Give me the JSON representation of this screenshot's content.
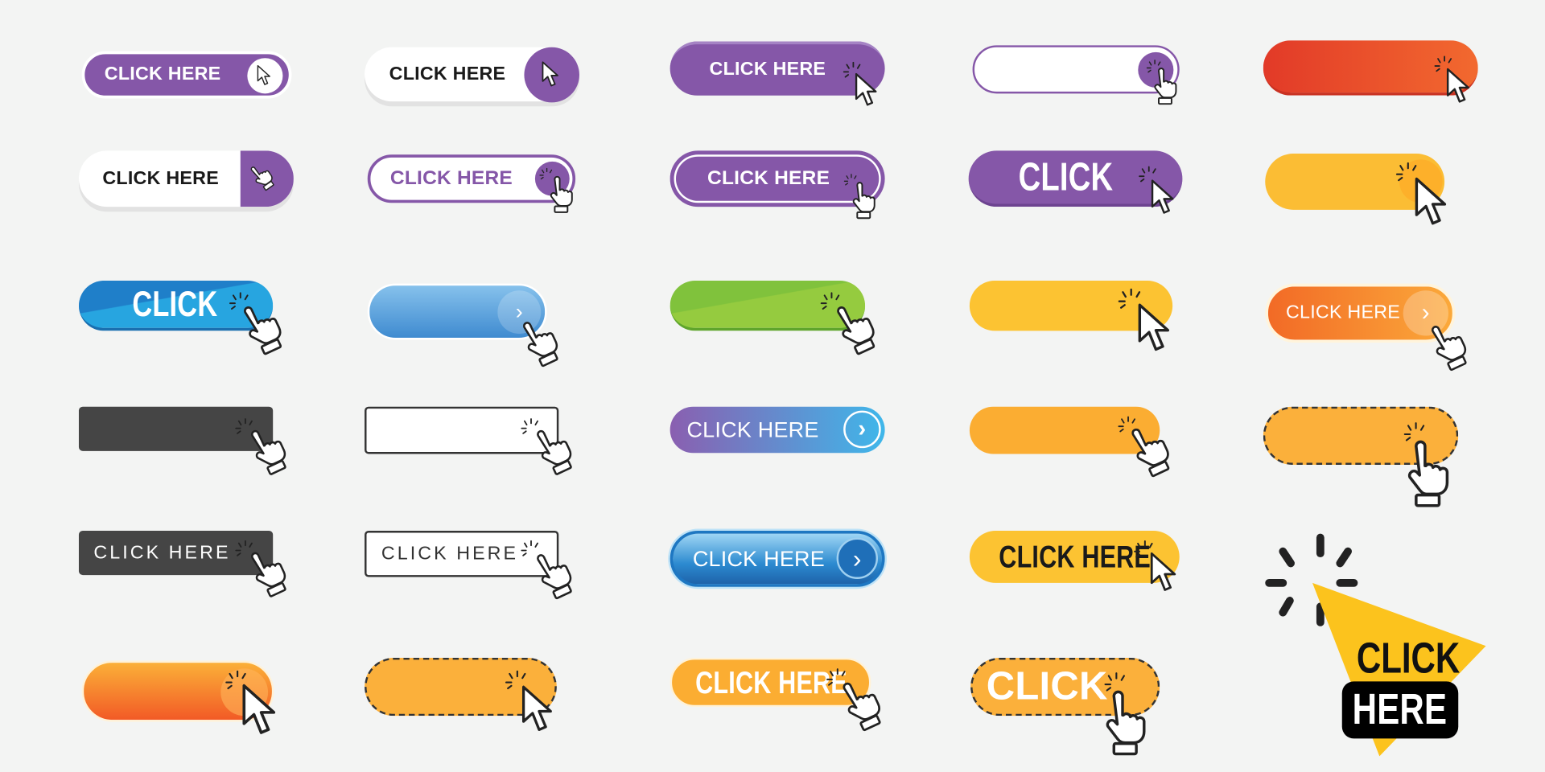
{
  "buttons": [
    {
      "label": "CLICK HERE",
      "color": "#8557a8",
      "icon": "arrow-cursor-icon"
    },
    {
      "label": "CLICK HERE",
      "color": "#ffffff",
      "accent": "#8557a8",
      "icon": "arrow-cursor-icon"
    },
    {
      "label": "CLICK HERE",
      "color": "#8557a8",
      "icon": "arrow-cursor-icon"
    },
    {
      "label": "",
      "color": "#ffffff",
      "accent": "#8557a8",
      "icon": "hand-pointer-icon"
    },
    {
      "label": "",
      "color": "#e8452c",
      "icon": "arrow-cursor-icon"
    },
    {
      "label": "CLICK HERE",
      "color": "#ffffff",
      "accent": "#8557a8",
      "icon": "hand-pointer-icon"
    },
    {
      "label": "CLICK HERE",
      "color": "#ffffff",
      "accent": "#8557a8",
      "icon": "hand-pointer-icon"
    },
    {
      "label": "CLICK HERE",
      "color": "#8557a8",
      "icon": "hand-pointer-icon"
    },
    {
      "label": "CLICK",
      "color": "#8557a8",
      "icon": "arrow-cursor-icon"
    },
    {
      "label": "",
      "color": "#fbbd34",
      "icon": "arrow-cursor-icon"
    },
    {
      "label": "CLICK",
      "color": "#1f8fd6",
      "icon": "hand-pointer-icon"
    },
    {
      "label": "",
      "color": "#4a97d8",
      "icon": "hand-pointer-icon"
    },
    {
      "label": "",
      "color": "#80c23c",
      "icon": "hand-pointer-icon"
    },
    {
      "label": "",
      "color": "#fcc332",
      "icon": "arrow-cursor-icon"
    },
    {
      "label": "CLICK HERE",
      "color": "#f46a25",
      "icon": "hand-pointer-icon"
    },
    {
      "label": "",
      "color": "#454545",
      "icon": "hand-pointer-icon"
    },
    {
      "label": "",
      "color": "#ffffff",
      "accent": "#333333",
      "icon": "hand-pointer-icon"
    },
    {
      "label": "CLICK HERE",
      "color": "#8a5fb0",
      "accent": "#3fb7ea",
      "icon": "chevron-right-icon"
    },
    {
      "label": "",
      "color": "#fbad32",
      "icon": "hand-pointer-icon"
    },
    {
      "label": "",
      "color": "#fbb03b",
      "icon": "hand-pointer-icon"
    },
    {
      "label": "CLICK HERE",
      "color": "#454545",
      "icon": "hand-pointer-icon"
    },
    {
      "label": "CLICK HERE",
      "color": "#ffffff",
      "accent": "#333333",
      "icon": "hand-pointer-icon"
    },
    {
      "label": "CLICK HERE",
      "color": "#1e77c2",
      "icon": "chevron-right-icon"
    },
    {
      "label": "CLICK HERE",
      "color": "#fcc332",
      "icon": "arrow-cursor-icon"
    },
    {
      "label_top": "CLICK",
      "label_bottom": "HERE",
      "color": "#fcc31d",
      "icon": "arrow-cursor-icon"
    },
    {
      "label": "",
      "color": "#f56b2a",
      "icon": "arrow-cursor-icon"
    },
    {
      "label": "",
      "color": "#fbb03b",
      "icon": "arrow-cursor-icon"
    },
    {
      "label": "CLICK HERE",
      "color": "#fbad32",
      "icon": "hand-pointer-icon"
    },
    {
      "label": "CLICK",
      "color": "#fbb03b",
      "icon": "hand-pointer-icon"
    }
  ]
}
